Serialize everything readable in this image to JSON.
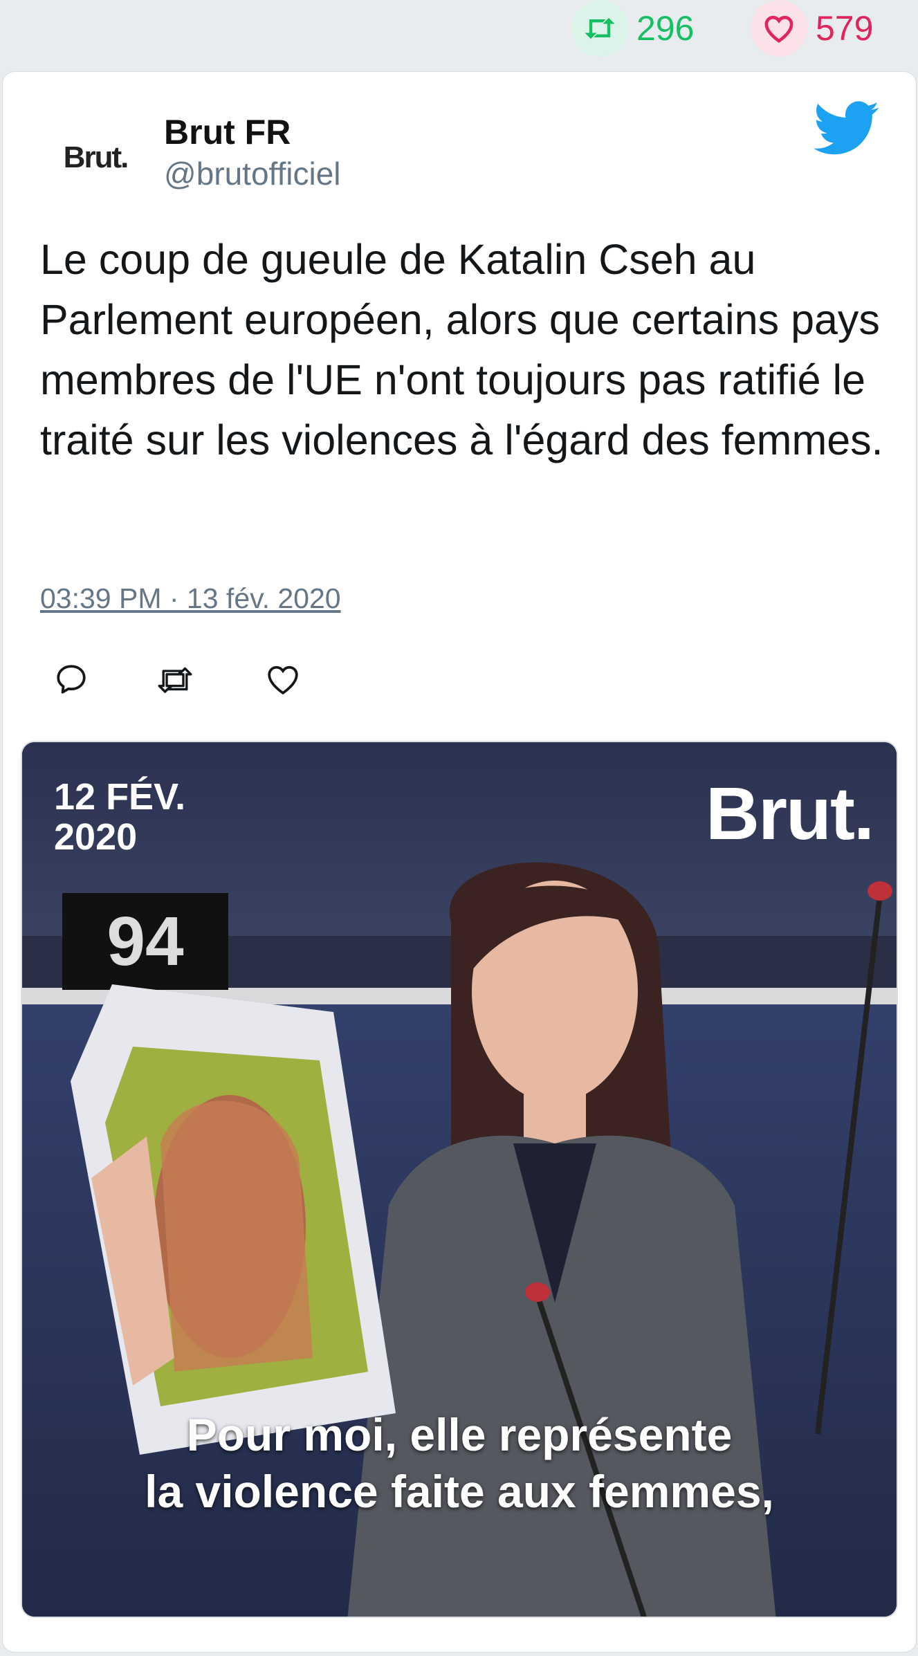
{
  "stats": {
    "retweets": "296",
    "likes": "579"
  },
  "author": {
    "avatar_text": "Brut.",
    "name": "Brut FR",
    "handle": "@brutofficiel"
  },
  "tweet": {
    "text": "Le coup de gueule de Katalin Cseh au Parlement européen, alors que certains pays membres de l'UE n'ont toujours pas ratifié le traité sur les violences à l'égard des femmes.",
    "timestamp": "03:39 PM · 13 fév. 2020"
  },
  "media": {
    "date_overlay": "12 FÉV.\n2020",
    "brand_overlay": "Brut.",
    "seat_number": "94",
    "subtitle": "Pour moi, elle représente\nla violence faite aux femmes,"
  },
  "colors": {
    "retweet": "#17bf63",
    "like": "#e0245e",
    "twitter": "#1da1f2",
    "muted": "#657786"
  }
}
